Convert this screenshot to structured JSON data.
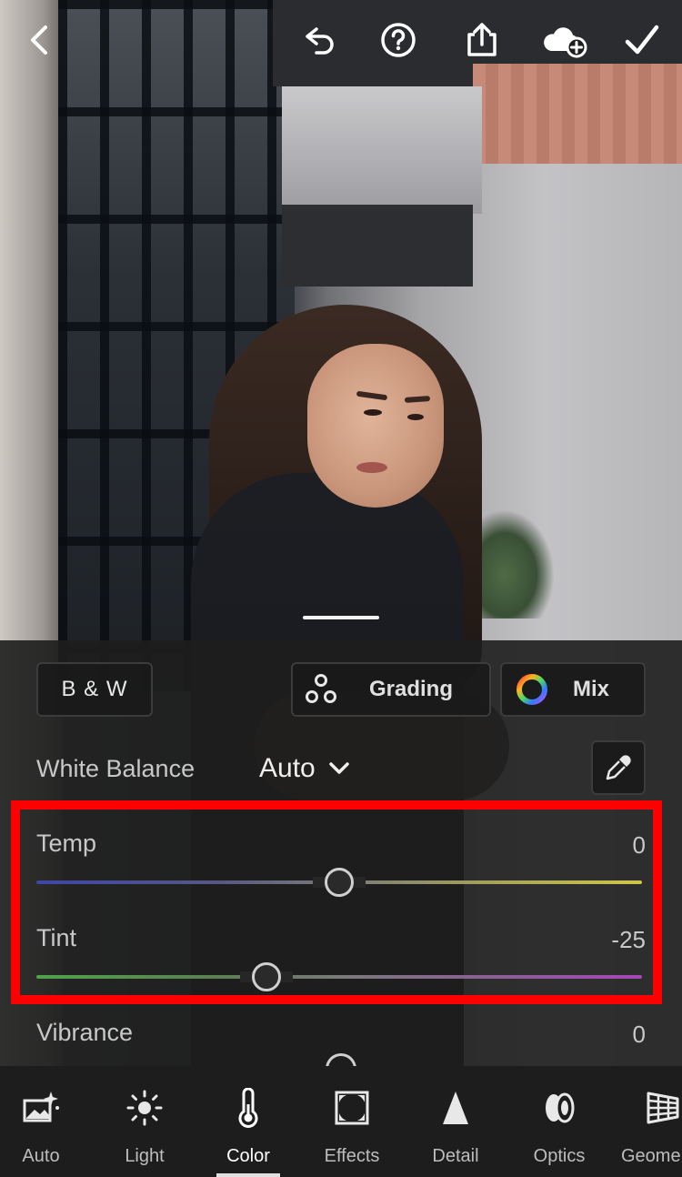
{
  "topbar": {
    "icons": [
      "back-chevron-icon",
      "undo-icon",
      "help-icon",
      "share-icon",
      "cloud-add-icon",
      "checkmark-icon"
    ]
  },
  "color_panel": {
    "bw_label": "B & W",
    "grading_label": "Grading",
    "mix_label": "Mix",
    "white_balance_label": "White Balance",
    "white_balance_value": "Auto",
    "sliders": [
      {
        "label": "Temp",
        "value": "0",
        "position": 0.5
      },
      {
        "label": "Tint",
        "value": "-25",
        "position": 0.38
      },
      {
        "label": "Vibrance",
        "value": "0",
        "position": 0.5
      }
    ],
    "highlight_color": "#ff0000"
  },
  "toolbar": {
    "tools": [
      {
        "label": "Auto",
        "icon": "auto-enhance-icon"
      },
      {
        "label": "Light",
        "icon": "sun-icon"
      },
      {
        "label": "Color",
        "icon": "thermometer-icon",
        "active": true
      },
      {
        "label": "Effects",
        "icon": "effects-vignette-icon"
      },
      {
        "label": "Detail",
        "icon": "detail-triangle-icon"
      },
      {
        "label": "Optics",
        "icon": "optics-lens-icon"
      },
      {
        "label": "Geome",
        "icon": "geometry-grid-icon"
      }
    ]
  }
}
